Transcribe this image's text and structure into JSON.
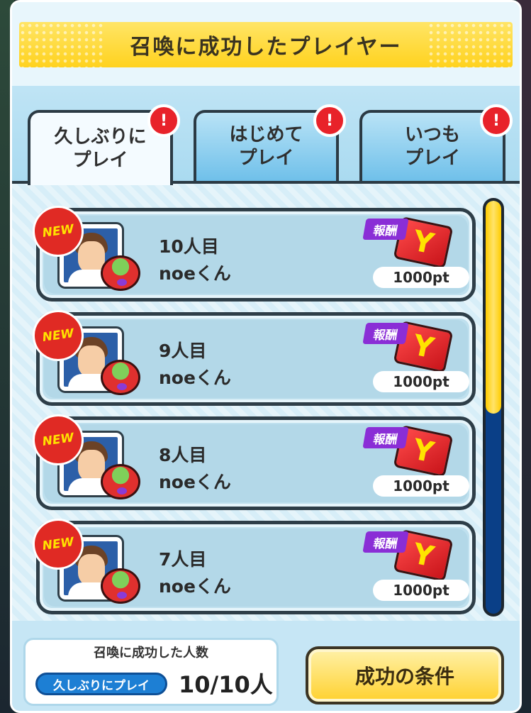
{
  "header": {
    "title": "召喚に成功したプレイヤー"
  },
  "tabs": [
    {
      "label": "久しぶりに\nプレイ",
      "badge": "!",
      "active": true
    },
    {
      "label": "はじめて\nプレイ",
      "badge": "!",
      "active": false
    },
    {
      "label": "いつも\nプレイ",
      "badge": "!",
      "active": false
    }
  ],
  "rows": [
    {
      "new": "NEW",
      "number": "10人目",
      "name": "noeくん",
      "reward_label": "報酬",
      "reward_icon": "Y",
      "reward_pt": "1000pt"
    },
    {
      "new": "NEW",
      "number": "9人目",
      "name": "noeくん",
      "reward_label": "報酬",
      "reward_icon": "Y",
      "reward_pt": "1000pt"
    },
    {
      "new": "NEW",
      "number": "8人目",
      "name": "noeくん",
      "reward_label": "報酬",
      "reward_icon": "Y",
      "reward_pt": "1000pt"
    },
    {
      "new": "NEW",
      "number": "7人目",
      "name": "noeくん",
      "reward_label": "報酬",
      "reward_icon": "Y",
      "reward_pt": "1000pt"
    }
  ],
  "footer": {
    "stats_title": "召喚に成功した人数",
    "stats_category": "久しぶりにプレイ",
    "stats_count": "10/10人",
    "condition_button": "成功の条件"
  },
  "colors": {
    "header_yellow": "#ffd21e",
    "badge_red": "#e8222a",
    "scroll_yellow": "#ffcc00",
    "scroll_track": "#0a3f87"
  }
}
